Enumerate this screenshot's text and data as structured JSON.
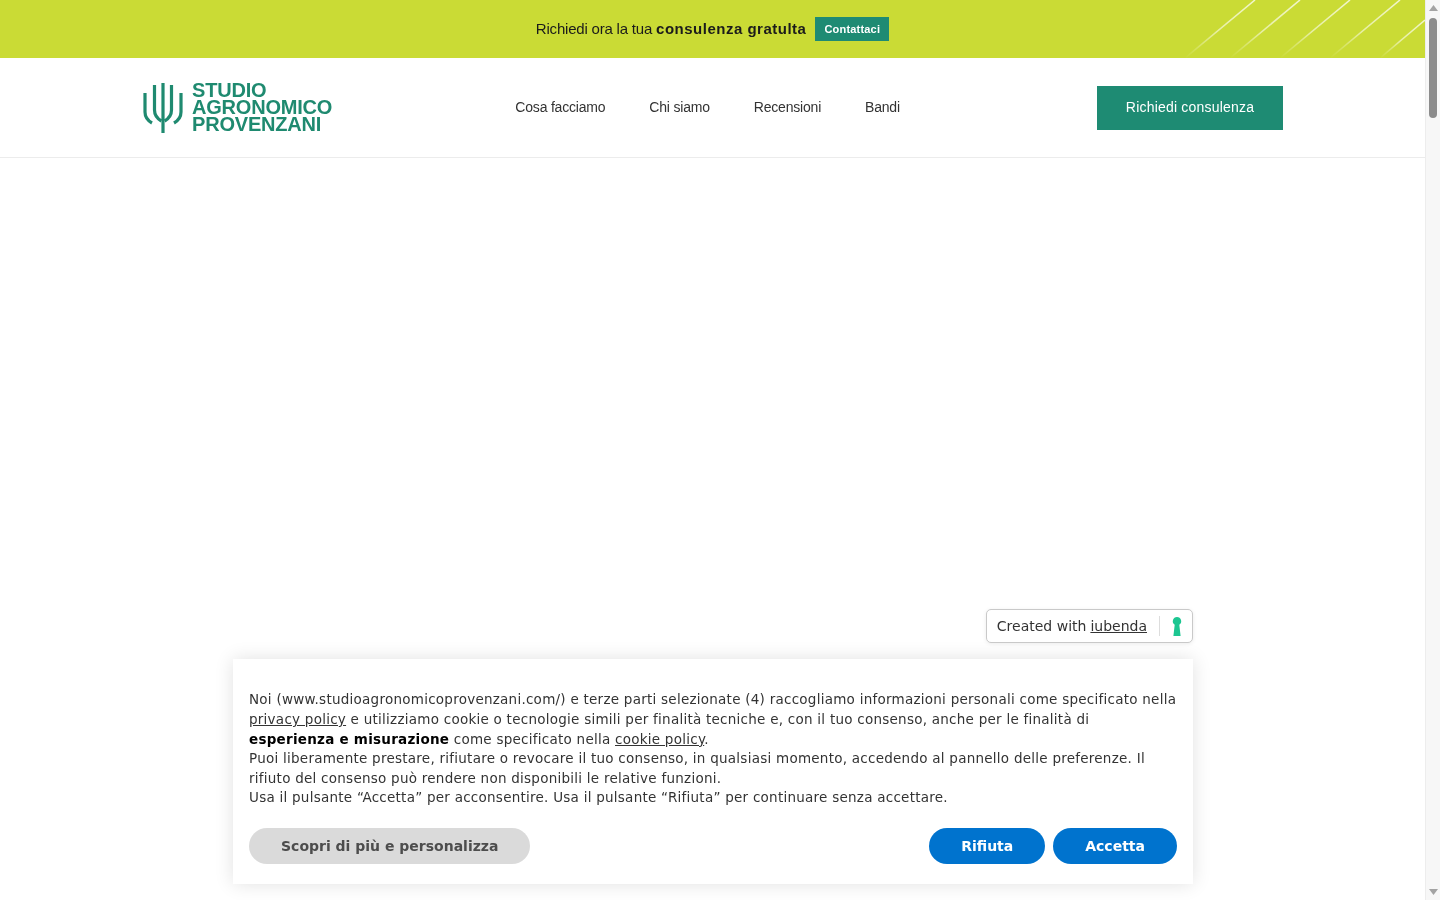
{
  "promo_bar": {
    "text": "Richiedi ora la tua **consulenza gratulta**",
    "button": "Contattaci"
  },
  "header": {
    "logo_lines": [
      "STUDIO",
      "AGRONOMICO",
      "PROVENZANI"
    ],
    "nav": [
      "Cosa facciamo",
      "Chi siamo",
      "Recensioni",
      "Bandi"
    ],
    "cta_button": "Richiedi consulenza"
  },
  "credit_badge": {
    "text": "Created with",
    "link": "iubenda"
  },
  "cookie_banner": {
    "paragraphs": [
      [
        {
          "kind": "text",
          "text": "Noi (www.studioagronomicoprovenzani.com/) e terze parti selezionate (4) raccogliamo informazioni personali come specificato nella "
        },
        {
          "kind": "link",
          "text": "privacy policy"
        },
        {
          "kind": "text",
          "text": " e utilizziamo cookie o tecnologie simili per finalità tecniche e, con il tuo consenso, anche per le finalità di **esperienza e misurazione** come specificato nella "
        },
        {
          "kind": "link",
          "text": "cookie policy"
        },
        {
          "kind": "text",
          "text": "."
        }
      ],
      [
        {
          "kind": "text",
          "text": "Puoi liberamente prestare, rifiutare o revocare il tuo consenso, in qualsiasi momento, accedendo al pannello delle preferenze. Il rifiuto del consenso può rendere non disponibili le relative funzioni."
        }
      ],
      [
        {
          "kind": "text",
          "text": "Usa il pulsante “Accetta” per acconsentire. Usa il pulsante “Rifiuta” per continuare senza accettare."
        }
      ]
    ],
    "buttons": [
      {
        "kind": "more",
        "label": "Scopri di più e personalizza"
      },
      {
        "kind": "reject",
        "label": "Rifiuta"
      },
      {
        "kind": "accept",
        "label": "Accetta"
      }
    ]
  }
}
